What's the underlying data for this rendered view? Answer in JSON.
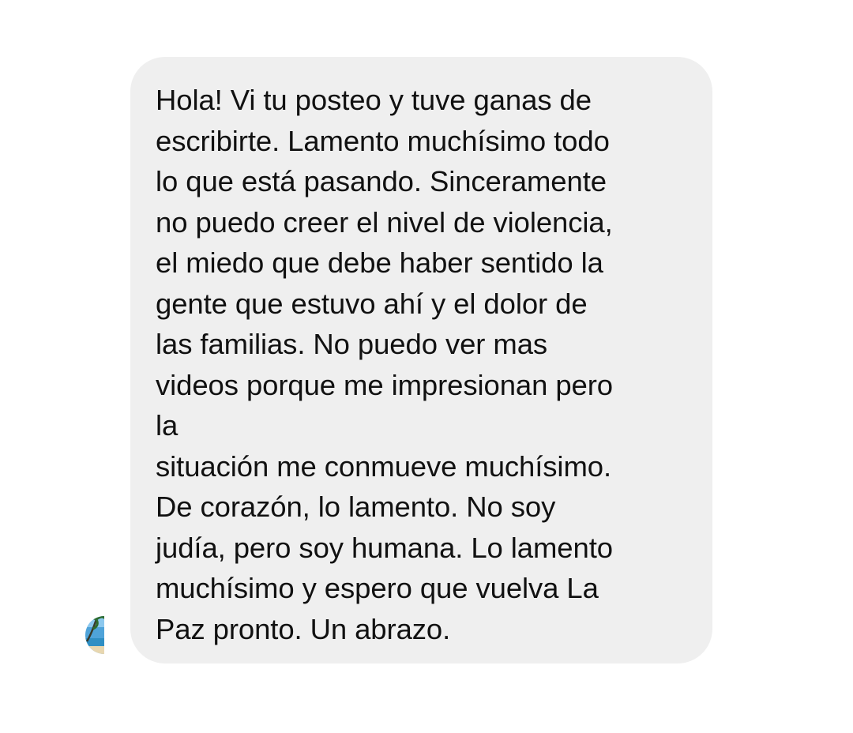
{
  "conversation": {
    "incoming_message": {
      "text": "Hola! Vi tu posteo y tuve ganas de\nescribirte. Lamento muchísimo todo\nlo que está pasando. Sinceramente\nno puedo creer el nivel de violencia,\nel miedo que debe haber sentido la\ngente que estuvo ahí y el dolor de\nlas familias. No puedo ver mas\nvideos porque me impresionan pero\nla\nsituación me conmueve muchísimo.\nDe corazón, lo lamento. No soy\njudía, pero soy humana. Lo lamento\nmuchísimo y espero que vuelva La\nPaz pronto. Un abrazo."
    },
    "sender_avatar": {
      "icon": "beach-palm-avatar-icon"
    }
  },
  "colors": {
    "background": "#ffffff",
    "bubble": "#efefef",
    "text": "#111111"
  }
}
